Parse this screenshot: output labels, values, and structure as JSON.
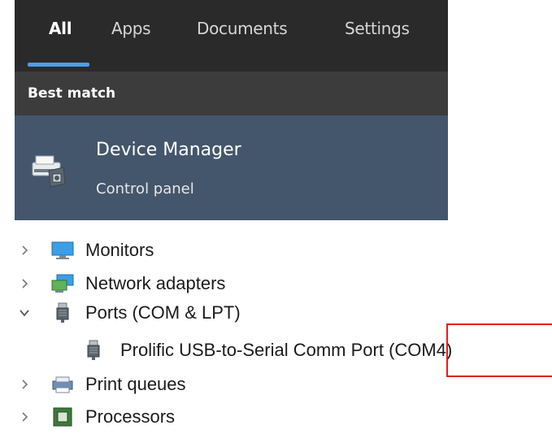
{
  "search": {
    "tabs": [
      {
        "label": "All",
        "active": true
      },
      {
        "label": "Apps",
        "active": false
      },
      {
        "label": "Documents",
        "active": false
      },
      {
        "label": "Settings",
        "active": false
      }
    ],
    "section_title": "Best match",
    "best_match": {
      "title": "Device Manager",
      "subtitle": "Control panel",
      "icon": "device-manager-icon"
    }
  },
  "device_tree": {
    "items": [
      {
        "label": "Monitors",
        "expanded": false,
        "icon": "monitor-icon"
      },
      {
        "label": "Network adapters",
        "expanded": false,
        "icon": "network-adapter-icon"
      },
      {
        "label": "Ports (COM & LPT)",
        "expanded": true,
        "icon": "port-icon"
      },
      {
        "label": "Prolific USB-to-Serial Comm Port (COM4)",
        "child": true,
        "icon": "port-icon"
      },
      {
        "label": "Print queues",
        "expanded": false,
        "icon": "printer-icon"
      },
      {
        "label": "Processors",
        "expanded": false,
        "icon": "processor-icon"
      }
    ]
  },
  "colors": {
    "accent_underline": "#4c9ee8",
    "selected_result": "#44566c",
    "highlight_box": "#e02020"
  }
}
